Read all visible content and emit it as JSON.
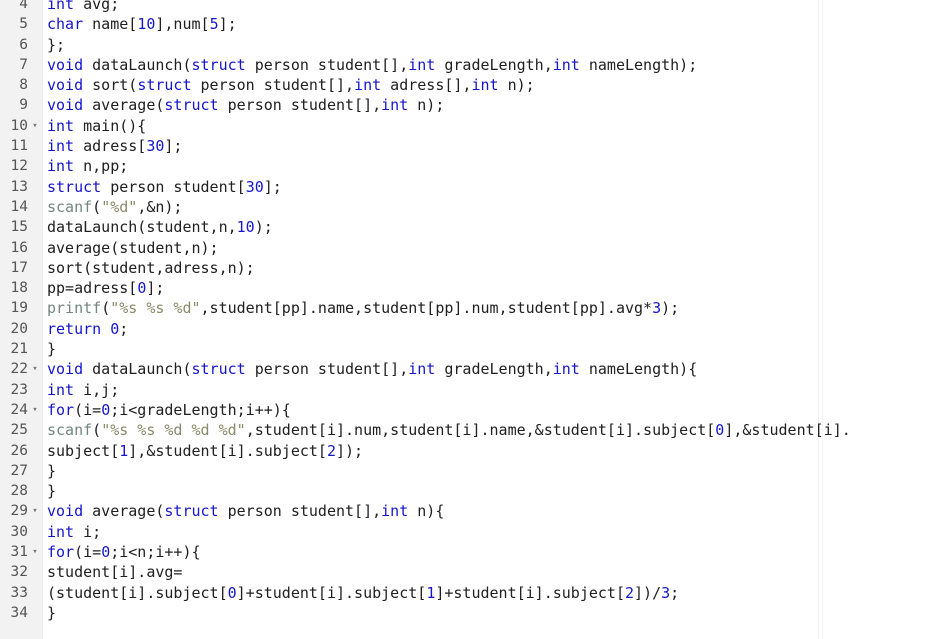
{
  "editor": {
    "language": "C",
    "colors": {
      "background": "#ffffff",
      "gutter_background": "#f2f2f2",
      "line_number": "#555555",
      "keyword": "#1515cf",
      "number": "#1515cf",
      "function": "#73877f",
      "string": "#8a8a6a",
      "plain_text": "#202020",
      "ruler_guide": "#f0f0f0"
    },
    "first_visible_line": 4,
    "last_visible_line": 34,
    "fold_marker_glyph": "▾",
    "lines": [
      {
        "number": "4",
        "fold": false,
        "clipped": true,
        "tokens": [
          {
            "t": "int",
            "c": "kw"
          },
          {
            "t": " avg;",
            "c": "pl"
          }
        ]
      },
      {
        "number": "5",
        "fold": false,
        "tokens": [
          {
            "t": "char",
            "c": "kw"
          },
          {
            "t": " name[",
            "c": "pl"
          },
          {
            "t": "10",
            "c": "num"
          },
          {
            "t": "],num[",
            "c": "pl"
          },
          {
            "t": "5",
            "c": "num"
          },
          {
            "t": "];",
            "c": "pl"
          }
        ]
      },
      {
        "number": "6",
        "fold": false,
        "tokens": [
          {
            "t": "};",
            "c": "pl"
          }
        ]
      },
      {
        "number": "7",
        "fold": false,
        "tokens": [
          {
            "t": "void",
            "c": "kw"
          },
          {
            "t": " dataLaunch(",
            "c": "pl"
          },
          {
            "t": "struct",
            "c": "kw"
          },
          {
            "t": " person student[],",
            "c": "pl"
          },
          {
            "t": "int",
            "c": "kw"
          },
          {
            "t": " gradeLength,",
            "c": "pl"
          },
          {
            "t": "int",
            "c": "kw"
          },
          {
            "t": " nameLength);",
            "c": "pl"
          }
        ]
      },
      {
        "number": "8",
        "fold": false,
        "tokens": [
          {
            "t": "void",
            "c": "kw"
          },
          {
            "t": " sort(",
            "c": "pl"
          },
          {
            "t": "struct",
            "c": "kw"
          },
          {
            "t": " person student[],",
            "c": "pl"
          },
          {
            "t": "int",
            "c": "kw"
          },
          {
            "t": " adress[],",
            "c": "pl"
          },
          {
            "t": "int",
            "c": "kw"
          },
          {
            "t": " n);",
            "c": "pl"
          }
        ]
      },
      {
        "number": "9",
        "fold": false,
        "tokens": [
          {
            "t": "void",
            "c": "kw"
          },
          {
            "t": " average(",
            "c": "pl"
          },
          {
            "t": "struct",
            "c": "kw"
          },
          {
            "t": " person student[],",
            "c": "pl"
          },
          {
            "t": "int",
            "c": "kw"
          },
          {
            "t": " n);",
            "c": "pl"
          }
        ]
      },
      {
        "number": "10",
        "fold": true,
        "tokens": [
          {
            "t": "int",
            "c": "kw"
          },
          {
            "t": " main(){",
            "c": "pl"
          }
        ]
      },
      {
        "number": "11",
        "fold": false,
        "tokens": [
          {
            "t": "int",
            "c": "kw"
          },
          {
            "t": " adress[",
            "c": "pl"
          },
          {
            "t": "30",
            "c": "num"
          },
          {
            "t": "];",
            "c": "pl"
          }
        ]
      },
      {
        "number": "12",
        "fold": false,
        "tokens": [
          {
            "t": "int",
            "c": "kw"
          },
          {
            "t": " n,pp;",
            "c": "pl"
          }
        ]
      },
      {
        "number": "13",
        "fold": false,
        "tokens": [
          {
            "t": "struct",
            "c": "kw"
          },
          {
            "t": " person student[",
            "c": "pl"
          },
          {
            "t": "30",
            "c": "num"
          },
          {
            "t": "];",
            "c": "pl"
          }
        ]
      },
      {
        "number": "14",
        "fold": false,
        "tokens": [
          {
            "t": "scanf",
            "c": "fn"
          },
          {
            "t": "(",
            "c": "pl"
          },
          {
            "t": "\"%d\"",
            "c": "str"
          },
          {
            "t": ",&n);",
            "c": "pl"
          }
        ]
      },
      {
        "number": "15",
        "fold": false,
        "tokens": [
          {
            "t": "dataLaunch(student,n,",
            "c": "pl"
          },
          {
            "t": "10",
            "c": "num"
          },
          {
            "t": ");",
            "c": "pl"
          }
        ]
      },
      {
        "number": "16",
        "fold": false,
        "tokens": [
          {
            "t": "average(student,n);",
            "c": "pl"
          }
        ]
      },
      {
        "number": "17",
        "fold": false,
        "tokens": [
          {
            "t": "sort(student,adress,n);",
            "c": "pl"
          }
        ]
      },
      {
        "number": "18",
        "fold": false,
        "tokens": [
          {
            "t": "pp=adress[",
            "c": "pl"
          },
          {
            "t": "0",
            "c": "num"
          },
          {
            "t": "];",
            "c": "pl"
          }
        ]
      },
      {
        "number": "19",
        "fold": false,
        "tokens": [
          {
            "t": "printf",
            "c": "fn"
          },
          {
            "t": "(",
            "c": "pl"
          },
          {
            "t": "\"%s %s %d\"",
            "c": "str"
          },
          {
            "t": ",student[pp].name,student[pp].num,student[pp].avg*",
            "c": "pl"
          },
          {
            "t": "3",
            "c": "num"
          },
          {
            "t": ");",
            "c": "pl"
          }
        ]
      },
      {
        "number": "20",
        "fold": false,
        "tokens": [
          {
            "t": "return",
            "c": "kw"
          },
          {
            "t": " ",
            "c": "pl"
          },
          {
            "t": "0",
            "c": "num"
          },
          {
            "t": ";",
            "c": "pl"
          }
        ]
      },
      {
        "number": "21",
        "fold": false,
        "tokens": [
          {
            "t": "}",
            "c": "pl"
          }
        ]
      },
      {
        "number": "22",
        "fold": true,
        "tokens": [
          {
            "t": "void",
            "c": "kw"
          },
          {
            "t": " dataLaunch(",
            "c": "pl"
          },
          {
            "t": "struct",
            "c": "kw"
          },
          {
            "t": " person student[],",
            "c": "pl"
          },
          {
            "t": "int",
            "c": "kw"
          },
          {
            "t": " gradeLength,",
            "c": "pl"
          },
          {
            "t": "int",
            "c": "kw"
          },
          {
            "t": " nameLength){",
            "c": "pl"
          }
        ]
      },
      {
        "number": "23",
        "fold": false,
        "tokens": [
          {
            "t": "int",
            "c": "kw"
          },
          {
            "t": " i,j;",
            "c": "pl"
          }
        ]
      },
      {
        "number": "24",
        "fold": true,
        "tokens": [
          {
            "t": "for",
            "c": "kw"
          },
          {
            "t": "(i=",
            "c": "pl"
          },
          {
            "t": "0",
            "c": "num"
          },
          {
            "t": ";i<gradeLength;i++){",
            "c": "pl"
          }
        ]
      },
      {
        "number": "25",
        "fold": false,
        "tokens": [
          {
            "t": "scanf",
            "c": "fn"
          },
          {
            "t": "(",
            "c": "pl"
          },
          {
            "t": "\"%s %s %d %d %d\"",
            "c": "str"
          },
          {
            "t": ",student[i].num,student[i].name,&student[i].subject[",
            "c": "pl"
          },
          {
            "t": "0",
            "c": "num"
          },
          {
            "t": "],&student[i].",
            "c": "pl"
          }
        ]
      },
      {
        "number": "26",
        "fold": false,
        "tokens": [
          {
            "t": "subject[",
            "c": "pl"
          },
          {
            "t": "1",
            "c": "num"
          },
          {
            "t": "],&student[i].subject[",
            "c": "pl"
          },
          {
            "t": "2",
            "c": "num"
          },
          {
            "t": "]);",
            "c": "pl"
          }
        ]
      },
      {
        "number": "27",
        "fold": false,
        "tokens": [
          {
            "t": "}",
            "c": "pl"
          }
        ]
      },
      {
        "number": "28",
        "fold": false,
        "tokens": [
          {
            "t": "}",
            "c": "pl"
          }
        ]
      },
      {
        "number": "29",
        "fold": true,
        "tokens": [
          {
            "t": "void",
            "c": "kw"
          },
          {
            "t": " average(",
            "c": "pl"
          },
          {
            "t": "struct",
            "c": "kw"
          },
          {
            "t": " person student[],",
            "c": "pl"
          },
          {
            "t": "int",
            "c": "kw"
          },
          {
            "t": " n){",
            "c": "pl"
          }
        ]
      },
      {
        "number": "30",
        "fold": false,
        "tokens": [
          {
            "t": "int",
            "c": "kw"
          },
          {
            "t": " i;",
            "c": "pl"
          }
        ]
      },
      {
        "number": "31",
        "fold": true,
        "tokens": [
          {
            "t": "for",
            "c": "kw"
          },
          {
            "t": "(i=",
            "c": "pl"
          },
          {
            "t": "0",
            "c": "num"
          },
          {
            "t": ";i<n;i++){",
            "c": "pl"
          }
        ]
      },
      {
        "number": "32",
        "fold": false,
        "tokens": [
          {
            "t": "student[i].avg=",
            "c": "pl"
          }
        ]
      },
      {
        "number": "33",
        "fold": false,
        "tokens": [
          {
            "t": "(student[i].subject[",
            "c": "pl"
          },
          {
            "t": "0",
            "c": "num"
          },
          {
            "t": "]+student[i].subject[",
            "c": "pl"
          },
          {
            "t": "1",
            "c": "num"
          },
          {
            "t": "]+student[i].subject[",
            "c": "pl"
          },
          {
            "t": "2",
            "c": "num"
          },
          {
            "t": "])/",
            "c": "pl"
          },
          {
            "t": "3",
            "c": "num"
          },
          {
            "t": ";",
            "c": "pl"
          }
        ]
      },
      {
        "number": "34",
        "fold": false,
        "tokens": [
          {
            "t": "}",
            "c": "pl"
          }
        ]
      }
    ]
  }
}
